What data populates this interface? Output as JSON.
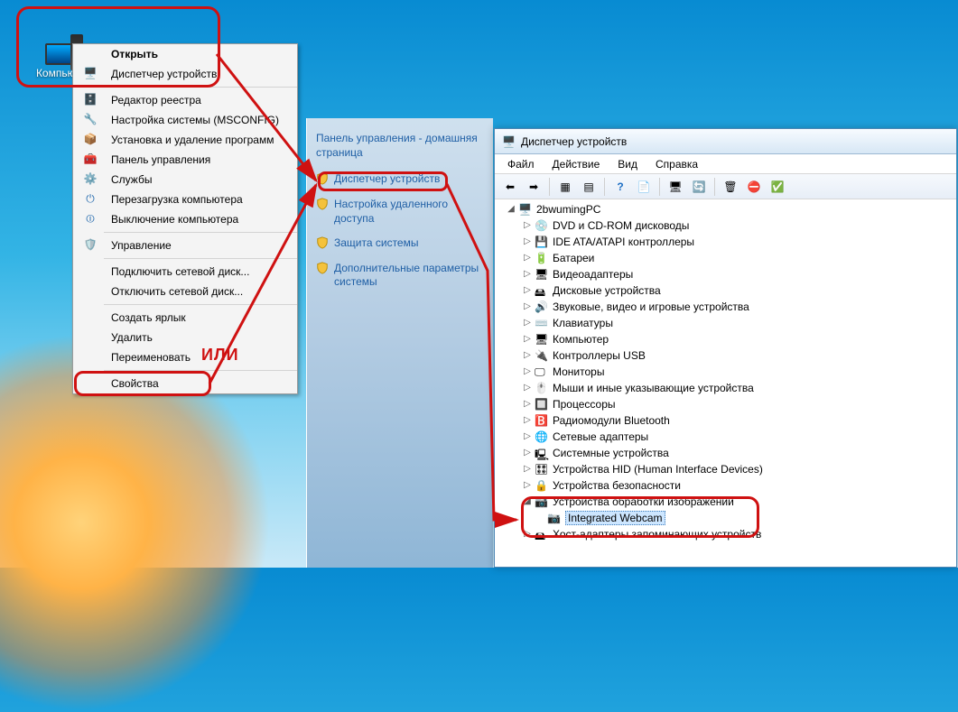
{
  "desktop": {
    "computer_label": "Компьютер"
  },
  "ctx": {
    "open": "Открыть",
    "devmgr": "Диспетчер устройств",
    "regedit": "Редактор реестра",
    "msconfig": "Настройка системы (MSCONFIG)",
    "addremove": "Установка и удаление программ",
    "controlpanel": "Панель управления",
    "services": "Службы",
    "restart": "Перезагрузка компьютера",
    "shutdown": "Выключение компьютера",
    "manage": "Управление",
    "mapdrive": "Подключить сетевой диск...",
    "unmapdrive": "Отключить сетевой диск...",
    "shortcut": "Создать ярлык",
    "delete": "Удалить",
    "rename": "Переименовать",
    "properties": "Свойства"
  },
  "or_label": "ИЛИ",
  "cp": {
    "heading": "Панель управления - домашняя страница",
    "devmgr": "Диспетчер устройств",
    "remote": "Настройка удаленного доступа",
    "sysprotect": "Защита системы",
    "advanced": "Дополнительные параметры системы"
  },
  "dm": {
    "title": "Диспетчер устройств",
    "menu": {
      "file": "Файл",
      "action": "Действие",
      "view": "Вид",
      "help": "Справка"
    },
    "root": "2bwumingPC",
    "categories": {
      "dvd": "DVD и CD-ROM дисководы",
      "ide": "IDE ATA/ATAPI контроллеры",
      "bat": "Батареи",
      "vid": "Видеоадаптеры",
      "disk": "Дисковые устройства",
      "snd": "Звуковые, видео и игровые устройства",
      "kbd": "Клавиатуры",
      "comp": "Компьютер",
      "usb": "Контроллеры USB",
      "mon": "Мониторы",
      "mouse": "Мыши и иные указывающие устройства",
      "cpu": "Процессоры",
      "bt": "Радиомодули Bluetooth",
      "net": "Сетевые адаптеры",
      "sys": "Системные устройства",
      "hid": "Устройства HID (Human Interface Devices)",
      "sec": "Устройства безопасности",
      "img": "Устройства обработки изображений",
      "host": "Хост-адаптеры запоминающих устройств"
    },
    "selected_leaf": "Integrated Webcam"
  }
}
